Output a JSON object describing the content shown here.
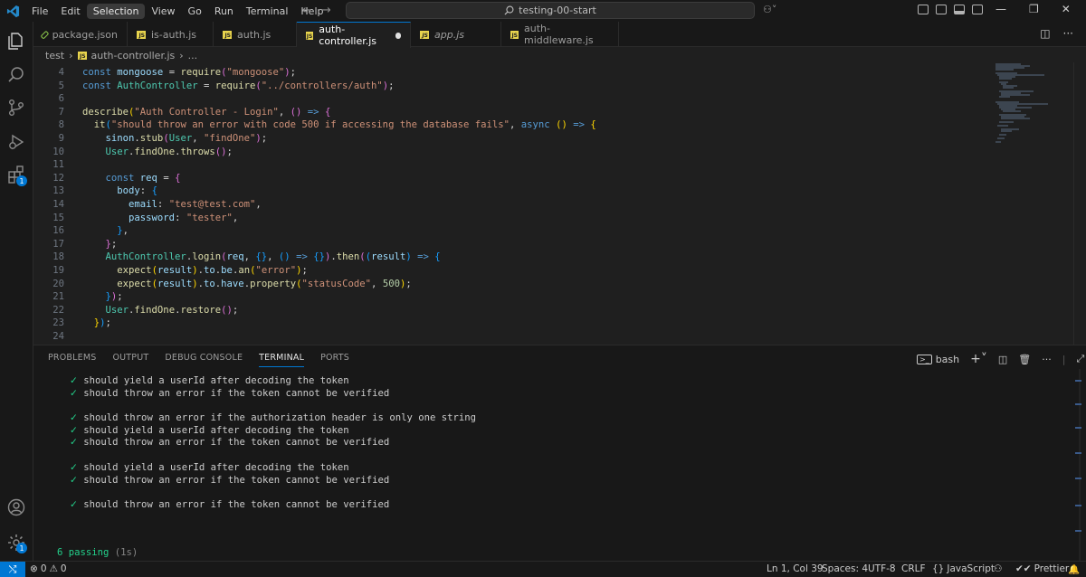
{
  "menu": [
    "File",
    "Edit",
    "Selection",
    "View",
    "Go",
    "Run",
    "Terminal",
    "Help"
  ],
  "menu_active": "Selection",
  "search": {
    "text": "testing-00-start"
  },
  "tabs": [
    {
      "label": "package.json",
      "icon": "node-icon",
      "active": false,
      "modified": false
    },
    {
      "label": "is-auth.js",
      "icon": "js-icon",
      "active": false,
      "modified": false
    },
    {
      "label": "auth.js",
      "icon": "js-icon",
      "active": false,
      "modified": false
    },
    {
      "label": "auth-controller.js",
      "icon": "js-icon",
      "active": true,
      "modified": true
    },
    {
      "label": "app.js",
      "icon": "js-icon",
      "active": false,
      "modified": false
    },
    {
      "label": "auth-middleware.js",
      "icon": "js-icon",
      "active": false,
      "modified": false
    }
  ],
  "breadcrumb": {
    "folder": "test",
    "file": "auth-controller.js",
    "symbol": "..."
  },
  "editor": {
    "line_numbers": [
      "4",
      "5",
      "6",
      "7",
      "8",
      "9",
      "10",
      "11",
      "12",
      "13",
      "14",
      "15",
      "16",
      "17",
      "18",
      "19",
      "20",
      "21",
      "22",
      "23",
      "24"
    ]
  },
  "panel": {
    "tabs": [
      "PROBLEMS",
      "OUTPUT",
      "DEBUG CONSOLE",
      "TERMINAL",
      "PORTS"
    ],
    "active_tab": "TERMINAL",
    "shell": "bash",
    "terminal_lines": [
      "should yield a userId after decoding the token",
      "should throw an error if the token cannot be verified",
      "",
      "should throw an error if the authorization header is only one string",
      "should yield a userId after decoding the token",
      "should throw an error if the token cannot be verified",
      "",
      "should yield a userId after decoding the token",
      "should throw an error if the token cannot be verified",
      "",
      "should throw an error if the token cannot be verified"
    ],
    "passing_count": "6 passing",
    "passing_time": "(1s)"
  },
  "activity_badges": {
    "extensions": "1",
    "accounts": "1"
  },
  "status": {
    "errors": "0",
    "warnings": "0",
    "position": "Ln 1, Col 39",
    "spaces": "Spaces: 4",
    "encoding": "UTF-8",
    "eol": "CRLF",
    "language": "JavaScript",
    "formatter": "Prettier"
  },
  "colors": {
    "accent": "#0078d4",
    "pass_green": "#23d18b",
    "editor_bg": "#1f1f1f",
    "chrome_bg": "#181818"
  }
}
